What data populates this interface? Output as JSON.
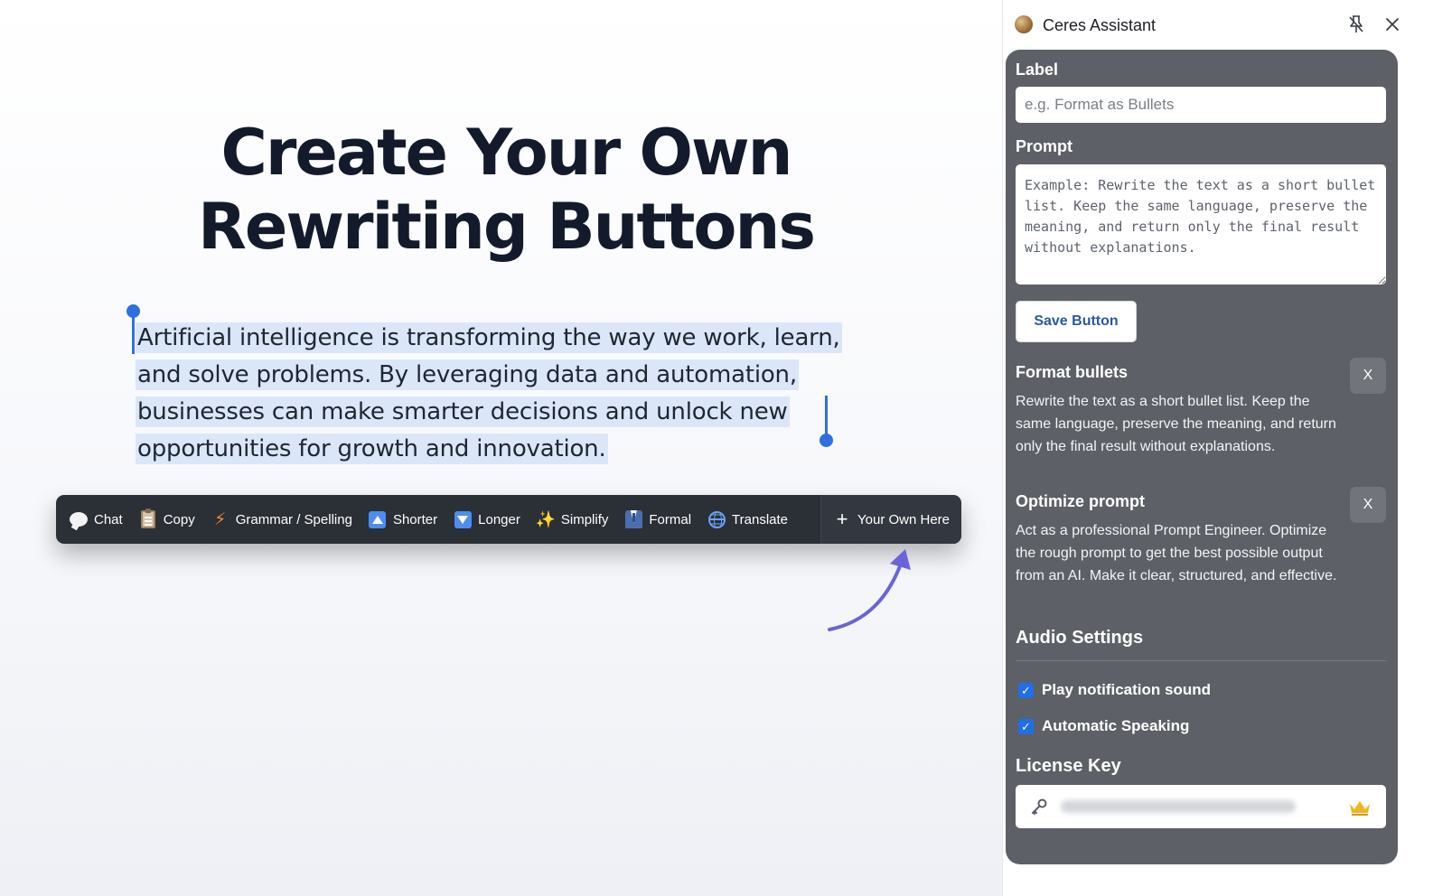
{
  "canvas": {
    "headline": [
      "Create Your Own",
      "Rewriting Buttons"
    ],
    "selected_text": "Artificial intelligence is transforming the way we work, learn, and solve problems. By leveraging data and automation, businesses can make smarter decisions and unlock new opportunities for growth and innovation."
  },
  "toolbar": {
    "buttons": [
      {
        "label": "Chat",
        "icon": "chat-bubble-icon"
      },
      {
        "label": "Copy",
        "icon": "clipboard-icon"
      },
      {
        "label": "Grammar / Spelling",
        "icon": "lightning-bolt-icon"
      },
      {
        "label": "Shorter",
        "icon": "triangle-up-icon"
      },
      {
        "label": "Longer",
        "icon": "triangle-down-icon"
      },
      {
        "label": "Simplify",
        "icon": "sparkles-icon"
      },
      {
        "label": "Formal",
        "icon": "suit-icon"
      },
      {
        "label": "Translate",
        "icon": "globe-icon"
      },
      {
        "label": "Your Own Here",
        "icon": "plus-icon"
      }
    ],
    "accent": "#2b2f36"
  },
  "panel": {
    "title": "Ceres Assistant",
    "label_heading": "Label",
    "label_placeholder": "e.g. Format as Bullets",
    "prompt_heading": "Prompt",
    "prompt_placeholder": "Example: Rewrite the text as a short bullet list. Keep the same language, preserve the meaning, and return only the final result without explanations.",
    "save_label": "Save Button",
    "custom_buttons": [
      {
        "title": "Format bullets",
        "description": "Rewrite the text as a short bullet list. Keep the same language, preserve the meaning, and return only the final result without explanations.",
        "remove_label": "X"
      },
      {
        "title": "Optimize prompt",
        "description": "Act as a professional Prompt Engineer. Optimize the rough prompt to get the best possible output from an AI. Make it clear, structured, and effective.",
        "remove_label": "X"
      }
    ],
    "audio_heading": "Audio Settings",
    "audio_options": [
      {
        "label": "Play notification sound",
        "checked": true
      },
      {
        "label": "Automatic Speaking",
        "checked": true
      }
    ],
    "license_heading": "License Key",
    "colors": {
      "panel_bg": "#5d6066",
      "checkbox": "#1f6fe8",
      "save_text": "#2b57a8",
      "selection": "#dbe6f8",
      "caret": "#2f6fe0"
    }
  }
}
